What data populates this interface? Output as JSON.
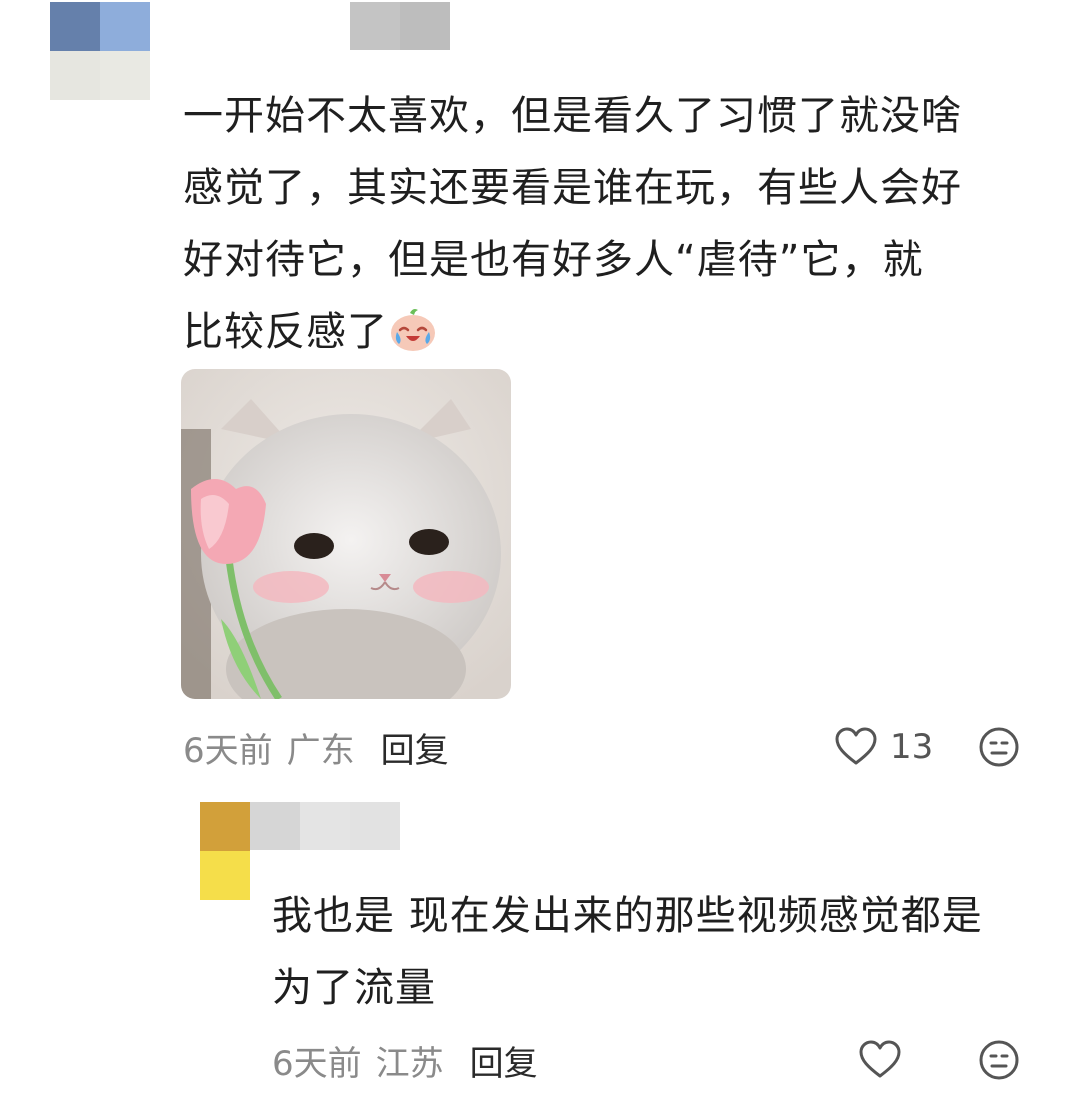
{
  "comment": {
    "text_lines": [
      "一开始不太喜欢，但是看久了习惯了就没啥",
      "感觉了，其实还要看是谁在玩，有些人会好",
      "好对待它，但是也有好多人“虐待”它，就",
      "比较反感了"
    ],
    "emoji": "laugh-cry-emoji",
    "sticker": "cat-with-tulip-sticker",
    "time": "6天前",
    "location": "广东",
    "reply_label": "回复",
    "like_count": "13"
  },
  "reply": {
    "text_lines": [
      "我也是 现在发出来的那些视频感觉都是",
      "为了流量"
    ],
    "time": "6天前",
    "location": "江苏",
    "reply_label": "回复"
  },
  "colors": {
    "avatar_main": [
      "#6580ab",
      "#8eaddb",
      "#e6e6e0",
      "#e9e9e3"
    ],
    "avatar_reply": [
      "#d2a03a",
      "#f5de4a"
    ],
    "name_blur": [
      "#c4c4c4",
      "#bdbdbd"
    ],
    "meta_text": "#8a8a8a",
    "body_text": "#1f1f1f"
  }
}
